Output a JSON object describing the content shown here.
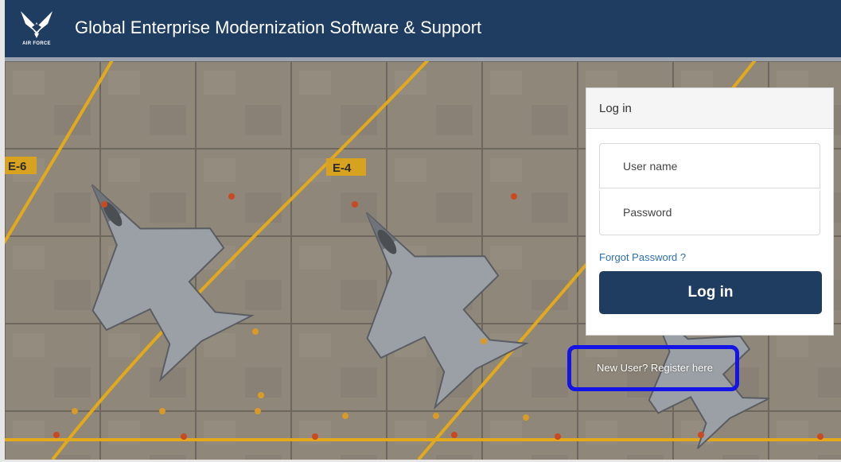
{
  "header": {
    "logo_text": "AIR FORCE",
    "title": "Global Enterprise Modernization Software & Support"
  },
  "hero": {
    "parking_labels": [
      "E-6",
      "E-4"
    ]
  },
  "login": {
    "panel_title": "Log in",
    "username_placeholder": "User name",
    "password_placeholder": "Password",
    "forgot_password": "Forgot Password ?",
    "login_button": "Log in",
    "register_link": "New User? Register here"
  },
  "colors": {
    "header_bg": "#1f3c61",
    "button_bg": "#1f3c61",
    "link": "#2d6fb3",
    "highlight": "#1414e6"
  }
}
